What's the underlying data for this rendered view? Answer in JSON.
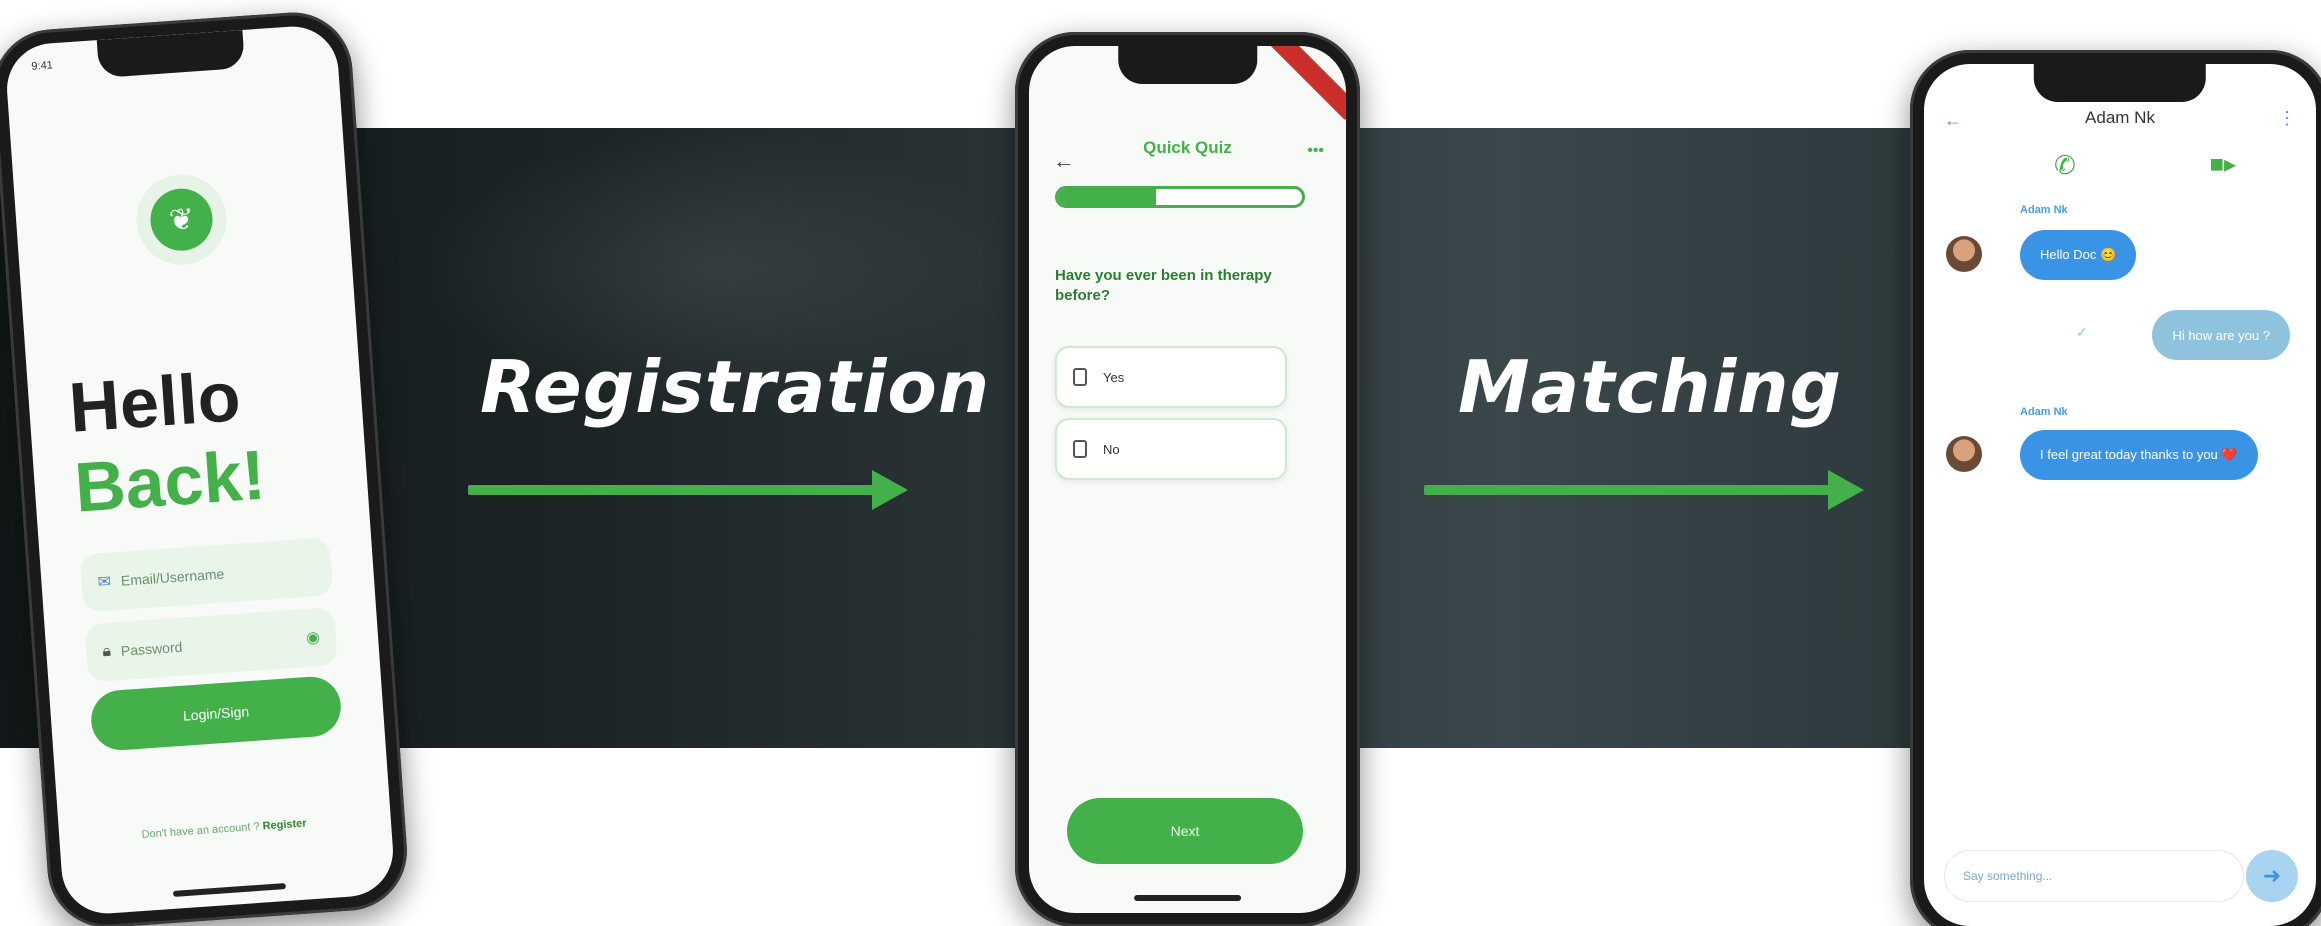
{
  "captions": {
    "step1": "Registration",
    "step2": "Matching"
  },
  "colors": {
    "brand_green": "#44b04a",
    "chat_blue": "#3a94e6",
    "background_dark": "#1c2426"
  },
  "login_screen": {
    "status_time": "9:41",
    "logo_icon": "leaf-hand-icon",
    "heading_line1": "Hello",
    "heading_line2": "Back!",
    "email_placeholder": "Email/Username",
    "password_placeholder": "Password",
    "login_button": "Login/Sign",
    "signup_prompt": "Don't have an account ?",
    "signup_link": "Register"
  },
  "quiz_screen": {
    "title": "Quick Quiz",
    "menu_label": "•••",
    "progress_fraction": 0.4,
    "question": "Have you ever been in therapy before?",
    "options": [
      "Yes",
      "No"
    ],
    "next_button": "Next"
  },
  "chat_screen": {
    "contact_name": "Adam Nk",
    "messages": [
      {
        "sender": "Adam Nk",
        "text": "Hello Doc 😊",
        "direction": "in"
      },
      {
        "sender": "",
        "text": "Hi how are you ?",
        "direction": "out"
      },
      {
        "sender": "Adam Nk",
        "text": "I feel great today thanks to you ❤️",
        "direction": "in"
      }
    ],
    "input_placeholder": "Say something...",
    "send_icon": "arrow-right-icon"
  }
}
